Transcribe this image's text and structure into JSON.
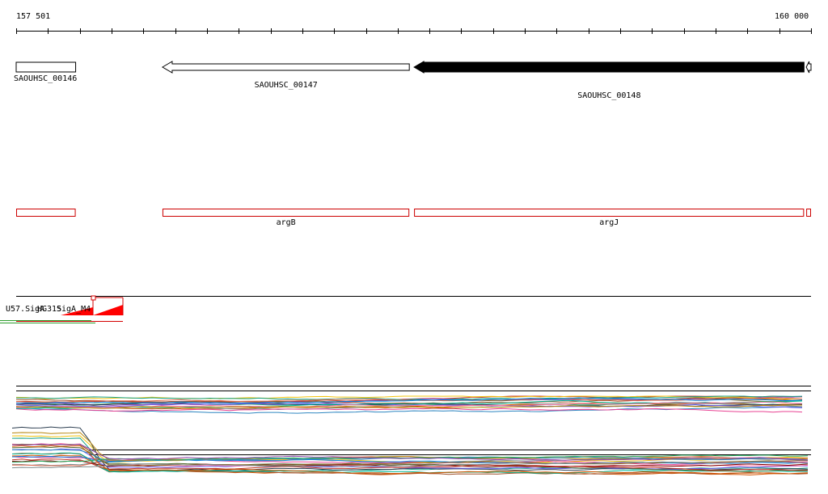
{
  "ruler": {
    "start_label": "157 501",
    "end_label": "160 000",
    "start": 157501,
    "end": 160000
  },
  "colors": {
    "feature_outline": "#000000",
    "feature_fill_selected": "#000000",
    "gene_outline": "#cc0000",
    "track_line": "#000000",
    "peak_fill": "#ff0000",
    "line_green": "#2e9e2e",
    "line_red": "#d40000"
  },
  "genes": [
    {
      "id": "g146",
      "label": "SAOUHSC_00146",
      "start": 157501,
      "end": 157688,
      "strand": "none",
      "filled": false
    },
    {
      "id": "g147",
      "label": "SAOUHSC_00147",
      "start": 157961,
      "end": 158737,
      "strand": "minus",
      "filled": false
    },
    {
      "id": "g148",
      "label": "SAOUHSC_00148",
      "start": 158752,
      "end": 159978,
      "strand": "minus",
      "filled": true
    },
    {
      "id": "g149",
      "label": "",
      "start": 159985,
      "end": 160000,
      "strand": "minus",
      "filled": false
    }
  ],
  "annotations": [
    {
      "id": "a1",
      "label": "",
      "start": 157501,
      "end": 157688
    },
    {
      "id": "a2",
      "label": "argB",
      "start": 157961,
      "end": 158737
    },
    {
      "id": "a3",
      "label": "argJ",
      "start": 158752,
      "end": 159978
    },
    {
      "id": "a4",
      "label": "",
      "start": 159985,
      "end": 160000
    }
  ],
  "signals": {
    "label_1": "U57.SigA",
    "label_2": "HG315",
    "label_3": "SigA_M4"
  }
}
